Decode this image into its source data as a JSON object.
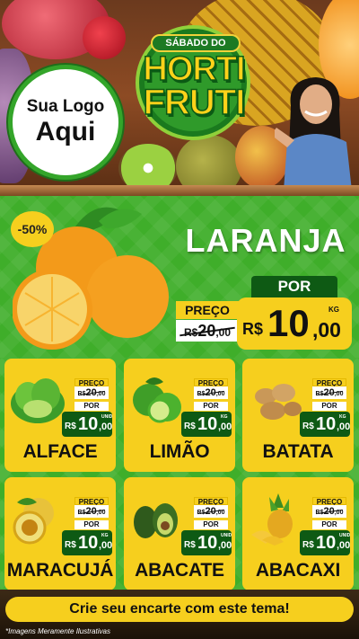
{
  "header": {
    "logo_line1": "Sua Logo",
    "logo_line2": "Aqui",
    "event_label": "SÁBADO DO",
    "title_line1": "HORTI",
    "title_line2": "FRUTI"
  },
  "hero": {
    "discount": "-50%",
    "product": "LARANJA",
    "preco_label": "PREÇO",
    "old_currency": "R$",
    "old_int": "20",
    "old_cents": ",00",
    "por_label": "POR",
    "new_currency": "R$",
    "new_int": "10",
    "new_cents": ",00",
    "unit": "KG"
  },
  "products": [
    {
      "name": "ALFACE",
      "preco_label": "PREÇO",
      "old_currency": "R$",
      "old_int": "20",
      "old_cents": ",00",
      "por_label": "POR",
      "currency": "R$",
      "int": "10",
      "cents": ",00",
      "unit": "UNID",
      "icon": "lettuce-icon"
    },
    {
      "name": "LIMÃO",
      "preco_label": "PREÇO",
      "old_currency": "R$",
      "old_int": "20",
      "old_cents": ",00",
      "por_label": "POR",
      "currency": "R$",
      "int": "10",
      "cents": ",00",
      "unit": "KG",
      "icon": "lime-icon"
    },
    {
      "name": "BATATA",
      "preco_label": "PREÇO",
      "old_currency": "R$",
      "old_int": "20",
      "old_cents": ",00",
      "por_label": "POR",
      "currency": "R$",
      "int": "10",
      "cents": ",00",
      "unit": "KG",
      "icon": "potato-icon"
    },
    {
      "name": "MARACUJÁ",
      "preco_label": "PREÇO",
      "old_currency": "R$",
      "old_int": "20",
      "old_cents": ",00",
      "por_label": "POR",
      "currency": "R$",
      "int": "10",
      "cents": ",00",
      "unit": "KG",
      "icon": "passion-fruit-icon"
    },
    {
      "name": "ABACATE",
      "preco_label": "PREÇO",
      "old_currency": "R$",
      "old_int": "20",
      "old_cents": ",00",
      "por_label": "POR",
      "currency": "R$",
      "int": "10",
      "cents": ",00",
      "unit": "UNID",
      "icon": "avocado-icon"
    },
    {
      "name": "ABACAXI",
      "preco_label": "PREÇO",
      "old_currency": "R$",
      "old_int": "20",
      "old_cents": ",00",
      "por_label": "POR",
      "currency": "R$",
      "int": "10",
      "cents": ",00",
      "unit": "UNID",
      "icon": "pineapple-icon"
    }
  ],
  "footer": {
    "cta": "Crie seu encarte com este tema!",
    "disclaimer": "*Imagens Meramente Ilustrativas"
  },
  "colors": {
    "green": "#3fae2a",
    "dark_green": "#0e5a14",
    "yellow": "#f6cf1e"
  }
}
